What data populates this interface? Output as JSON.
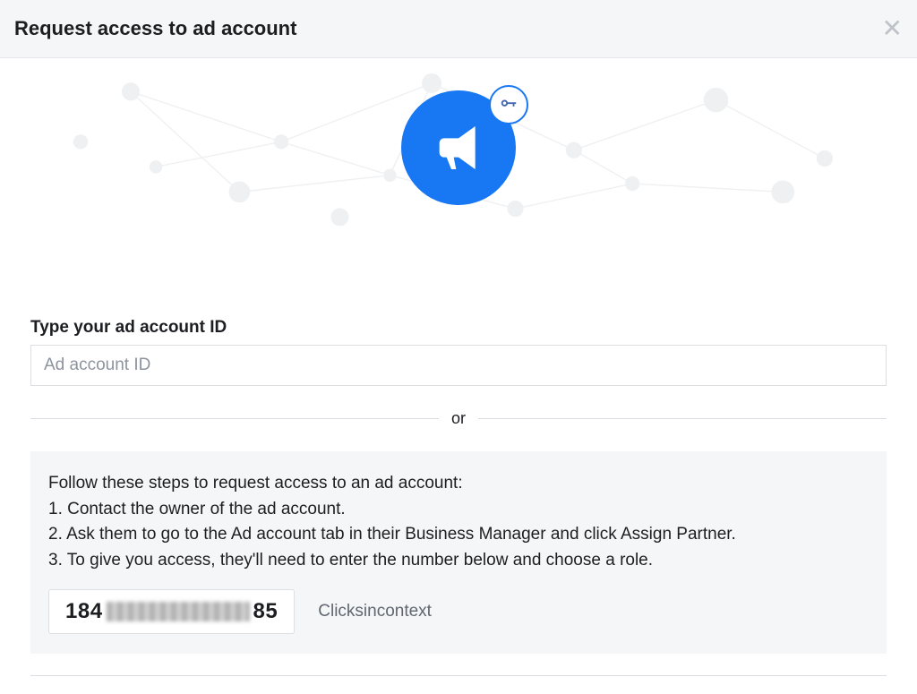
{
  "header": {
    "title": "Request access to ad account"
  },
  "form": {
    "label": "Type your ad account ID",
    "placeholder": "Ad account ID",
    "separator": "or"
  },
  "steps": {
    "intro": "Follow these steps to request access to an ad account:",
    "step1": "1. Contact the owner of the ad account.",
    "step2": "2. Ask them to go to the Ad account tab in their Business Manager and click Assign Partner.",
    "step3": "3. To give you access, they'll need to enter the number below and choose a role."
  },
  "share": {
    "id_prefix": "184",
    "id_suffix": "85",
    "org_name": "Clicksincontext"
  }
}
